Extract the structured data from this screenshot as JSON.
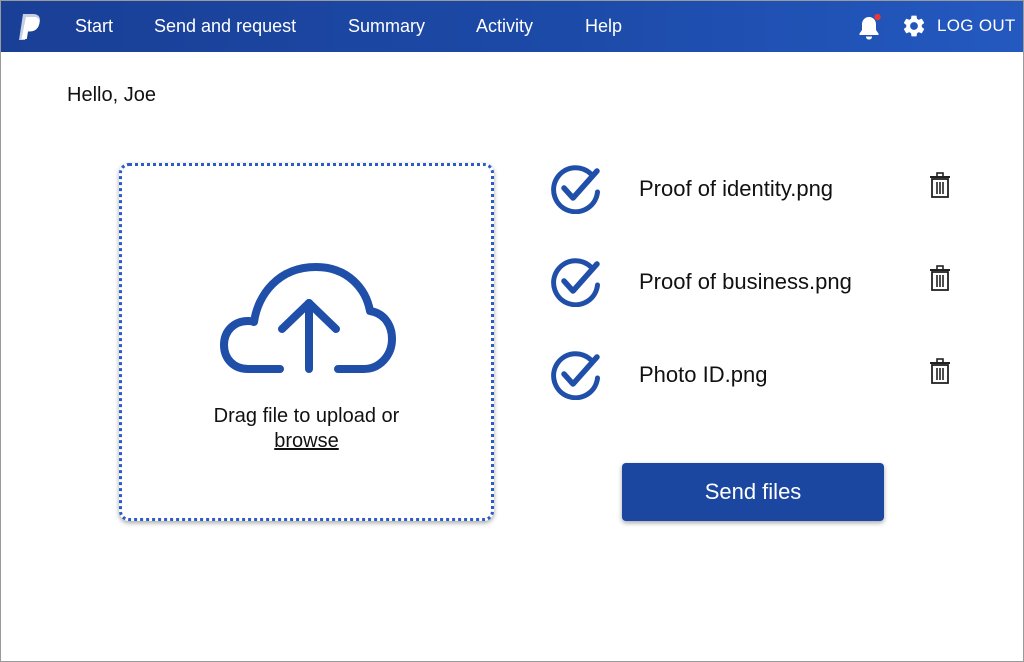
{
  "nav": {
    "logo_icon": "paypal-logo-icon",
    "links": [
      "Start",
      "Send and request",
      "Summary",
      "Activity",
      "Help"
    ],
    "notification_icon": "bell-icon",
    "notification_badge_color": "#e53935",
    "settings_icon": "gear-icon",
    "logout_label": "LOG OUT"
  },
  "greeting": "Hello, Joe",
  "upload": {
    "icon": "cloud-upload-icon",
    "prompt": "Drag file to upload or",
    "browse_label": "browse"
  },
  "files": [
    {
      "name": "Proof of identity.png",
      "status_icon": "check-circle-icon",
      "delete_icon": "trash-icon"
    },
    {
      "name": "Proof of business.png",
      "status_icon": "check-circle-icon",
      "delete_icon": "trash-icon"
    },
    {
      "name": "Photo ID.png",
      "status_icon": "check-circle-icon",
      "delete_icon": "trash-icon"
    }
  ],
  "send_button_label": "Send files",
  "colors": {
    "nav_bg": "#1c4aa8",
    "accent": "#1b47a0",
    "icon_blue": "#1f4fa8",
    "dropzone_border": "#2a5cc7"
  }
}
